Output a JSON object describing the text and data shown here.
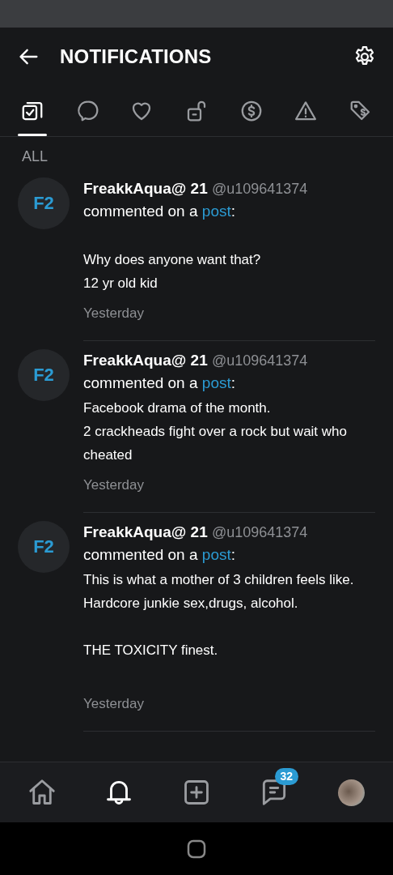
{
  "header": {
    "title": "NOTIFICATIONS"
  },
  "tabs": [
    {
      "kind": "all",
      "selected": true
    },
    {
      "kind": "comment",
      "selected": false
    },
    {
      "kind": "like",
      "selected": false
    },
    {
      "kind": "unlock",
      "selected": false
    },
    {
      "kind": "tip",
      "selected": false
    },
    {
      "kind": "warning",
      "selected": false
    },
    {
      "kind": "promo",
      "selected": false
    }
  ],
  "section_label": "ALL",
  "notifications": [
    {
      "avatar": "F2",
      "name": "FreakkAqua@ 21",
      "handle": "@u109641374",
      "action": "commented on a",
      "link": "post",
      "punct": ":",
      "body": "\nWhy does anyone want that?\n12 yr old kid",
      "time": "Yesterday"
    },
    {
      "avatar": "F2",
      "name": "FreakkAqua@ 21",
      "handle": "@u109641374",
      "action": "commented on a",
      "link": "post",
      "punct": ":",
      "body": "Facebook drama of the month.\n2 crackheads fight over a rock but wait who cheated",
      "time": "Yesterday"
    },
    {
      "avatar": "F2",
      "name": "FreakkAqua@ 21",
      "handle": "@u109641374",
      "action": "commented on a",
      "link": "post",
      "punct": ":",
      "body": "This is what a mother of 3 children feels like. Hardcore junkie sex,drugs, alcohol.\n\nTHE TOXICITY finest.\n\n",
      "time": "Yesterday"
    }
  ],
  "bottom_nav": [
    {
      "kind": "home",
      "selected": false
    },
    {
      "kind": "bell",
      "selected": true
    },
    {
      "kind": "add",
      "selected": false
    },
    {
      "kind": "messages",
      "selected": false,
      "badge": "32"
    },
    {
      "kind": "profile",
      "selected": false
    }
  ]
}
